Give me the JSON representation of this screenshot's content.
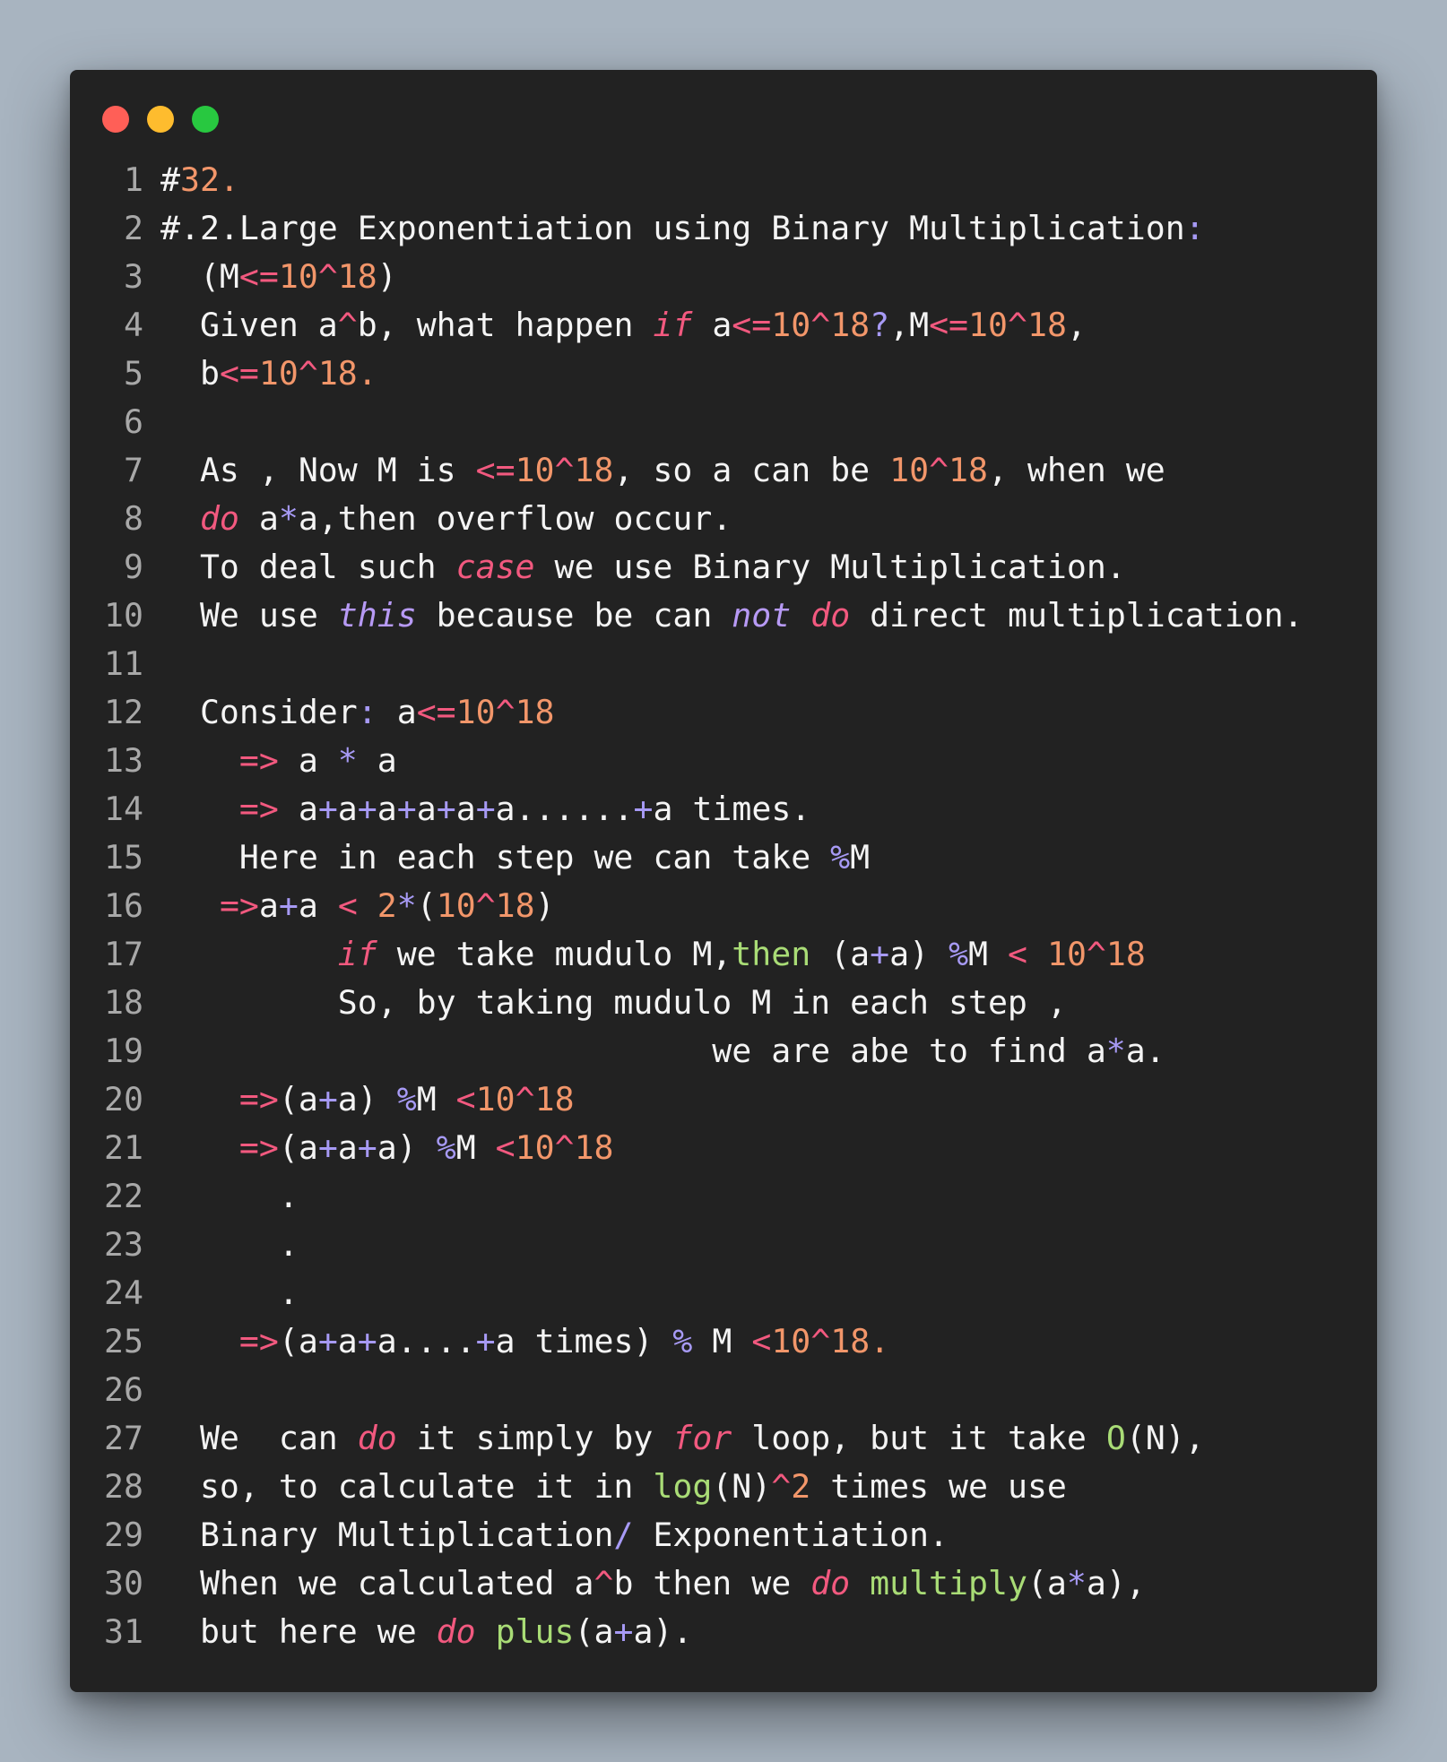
{
  "window": {
    "buttons": [
      {
        "name": "close",
        "color": "#ff5f57"
      },
      {
        "name": "minimize",
        "color": "#febc2e"
      },
      {
        "name": "zoom",
        "color": "#28c840"
      }
    ]
  },
  "colors": {
    "background": "#a8b4c0",
    "editor": "#222222",
    "text": "#f4f4f4",
    "line_number": "#a8a8a8",
    "number": "#f2966a",
    "operator": "#f2597f",
    "punctuation": "#a79af5",
    "keyword": "#f2597f",
    "keyword2": "#b79af5",
    "function": "#a9dc76"
  },
  "lines": [
    {
      "n": "1",
      "tokens": [
        [
          "text",
          "#"
        ],
        [
          "num",
          "32."
        ]
      ]
    },
    {
      "n": "2",
      "tokens": [
        [
          "text",
          "#.2.Large Exponentiation using Binary Multiplication"
        ],
        [
          "punct",
          ":"
        ]
      ]
    },
    {
      "n": "3",
      "tokens": [
        [
          "text",
          "  (M"
        ],
        [
          "op",
          "<="
        ],
        [
          "num",
          "10"
        ],
        [
          "op",
          "^"
        ],
        [
          "num",
          "18"
        ],
        [
          "text",
          ")"
        ]
      ]
    },
    {
      "n": "4",
      "tokens": [
        [
          "text",
          "  Given a"
        ],
        [
          "op",
          "^"
        ],
        [
          "text",
          "b, what happen "
        ],
        [
          "kw",
          "if"
        ],
        [
          "text",
          " a"
        ],
        [
          "op",
          "<="
        ],
        [
          "num",
          "10"
        ],
        [
          "op",
          "^"
        ],
        [
          "num",
          "18"
        ],
        [
          "punct",
          "?"
        ],
        [
          "text",
          ",M"
        ],
        [
          "op",
          "<="
        ],
        [
          "num",
          "10"
        ],
        [
          "op",
          "^"
        ],
        [
          "num",
          "18"
        ],
        [
          "text",
          ","
        ]
      ]
    },
    {
      "n": "5",
      "tokens": [
        [
          "text",
          "  b"
        ],
        [
          "op",
          "<="
        ],
        [
          "num",
          "10"
        ],
        [
          "op",
          "^"
        ],
        [
          "num",
          "18."
        ]
      ]
    },
    {
      "n": "6",
      "tokens": []
    },
    {
      "n": "7",
      "tokens": [
        [
          "text",
          "  As , Now M is "
        ],
        [
          "op",
          "<="
        ],
        [
          "num",
          "10"
        ],
        [
          "op",
          "^"
        ],
        [
          "num",
          "18"
        ],
        [
          "text",
          ", so a can be "
        ],
        [
          "num",
          "10"
        ],
        [
          "op",
          "^"
        ],
        [
          "num",
          "18"
        ],
        [
          "text",
          ", when we"
        ]
      ]
    },
    {
      "n": "8",
      "tokens": [
        [
          "text",
          "  "
        ],
        [
          "kw",
          "do"
        ],
        [
          "text",
          " a"
        ],
        [
          "punct",
          "*"
        ],
        [
          "text",
          "a,then overflow occur."
        ]
      ]
    },
    {
      "n": "9",
      "tokens": [
        [
          "text",
          "  To deal such "
        ],
        [
          "kw",
          "case"
        ],
        [
          "text",
          " we use Binary Multiplication."
        ]
      ]
    },
    {
      "n": "10",
      "tokens": [
        [
          "text",
          "  We use "
        ],
        [
          "kw2",
          "this"
        ],
        [
          "text",
          " because be can "
        ],
        [
          "kw2",
          "not"
        ],
        [
          "text",
          " "
        ],
        [
          "kw",
          "do"
        ],
        [
          "text",
          " direct multiplication."
        ]
      ]
    },
    {
      "n": "11",
      "tokens": []
    },
    {
      "n": "12",
      "tokens": [
        [
          "text",
          "  Consider"
        ],
        [
          "punct",
          ":"
        ],
        [
          "text",
          " a"
        ],
        [
          "op",
          "<="
        ],
        [
          "num",
          "10"
        ],
        [
          "op",
          "^"
        ],
        [
          "num",
          "18"
        ]
      ]
    },
    {
      "n": "13",
      "tokens": [
        [
          "text",
          "    "
        ],
        [
          "op",
          "=>"
        ],
        [
          "text",
          " a "
        ],
        [
          "punct",
          "*"
        ],
        [
          "text",
          " a"
        ]
      ]
    },
    {
      "n": "14",
      "tokens": [
        [
          "text",
          "    "
        ],
        [
          "op",
          "=>"
        ],
        [
          "text",
          " a"
        ],
        [
          "punct",
          "+"
        ],
        [
          "text",
          "a"
        ],
        [
          "punct",
          "+"
        ],
        [
          "text",
          "a"
        ],
        [
          "punct",
          "+"
        ],
        [
          "text",
          "a"
        ],
        [
          "punct",
          "+"
        ],
        [
          "text",
          "a"
        ],
        [
          "punct",
          "+"
        ],
        [
          "text",
          "a......"
        ],
        [
          "punct",
          "+"
        ],
        [
          "text",
          "a times."
        ]
      ]
    },
    {
      "n": "15",
      "tokens": [
        [
          "text",
          "    Here in each step we can take "
        ],
        [
          "punct",
          "%"
        ],
        [
          "text",
          "M"
        ]
      ]
    },
    {
      "n": "16",
      "tokens": [
        [
          "text",
          "   "
        ],
        [
          "op",
          "=>"
        ],
        [
          "text",
          "a"
        ],
        [
          "punct",
          "+"
        ],
        [
          "text",
          "a "
        ],
        [
          "op",
          "<"
        ],
        [
          "text",
          " "
        ],
        [
          "num",
          "2"
        ],
        [
          "punct",
          "*"
        ],
        [
          "text",
          "("
        ],
        [
          "num",
          "10"
        ],
        [
          "op",
          "^"
        ],
        [
          "num",
          "18"
        ],
        [
          "text",
          ")"
        ]
      ]
    },
    {
      "n": "17",
      "tokens": [
        [
          "text",
          "         "
        ],
        [
          "kw",
          "if"
        ],
        [
          "text",
          " we take mudulo M,"
        ],
        [
          "fn",
          "then"
        ],
        [
          "text",
          " (a"
        ],
        [
          "punct",
          "+"
        ],
        [
          "text",
          "a) "
        ],
        [
          "punct",
          "%"
        ],
        [
          "text",
          "M "
        ],
        [
          "op",
          "<"
        ],
        [
          "text",
          " "
        ],
        [
          "num",
          "10"
        ],
        [
          "op",
          "^"
        ],
        [
          "num",
          "18"
        ]
      ]
    },
    {
      "n": "18",
      "tokens": [
        [
          "text",
          "         So, by taking mudulo M in each step ,"
        ]
      ]
    },
    {
      "n": "19",
      "tokens": [
        [
          "text",
          "                            we are abe to find a"
        ],
        [
          "punct",
          "*"
        ],
        [
          "text",
          "a."
        ]
      ]
    },
    {
      "n": "20",
      "tokens": [
        [
          "text",
          "    "
        ],
        [
          "op",
          "=>"
        ],
        [
          "text",
          "(a"
        ],
        [
          "punct",
          "+"
        ],
        [
          "text",
          "a) "
        ],
        [
          "punct",
          "%"
        ],
        [
          "text",
          "M "
        ],
        [
          "op",
          "<"
        ],
        [
          "num",
          "10"
        ],
        [
          "op",
          "^"
        ],
        [
          "num",
          "18"
        ]
      ]
    },
    {
      "n": "21",
      "tokens": [
        [
          "text",
          "    "
        ],
        [
          "op",
          "=>"
        ],
        [
          "text",
          "(a"
        ],
        [
          "punct",
          "+"
        ],
        [
          "text",
          "a"
        ],
        [
          "punct",
          "+"
        ],
        [
          "text",
          "a) "
        ],
        [
          "punct",
          "%"
        ],
        [
          "text",
          "M "
        ],
        [
          "op",
          "<"
        ],
        [
          "num",
          "10"
        ],
        [
          "op",
          "^"
        ],
        [
          "num",
          "18"
        ]
      ]
    },
    {
      "n": "22",
      "tokens": [
        [
          "text",
          "      ."
        ]
      ]
    },
    {
      "n": "23",
      "tokens": [
        [
          "text",
          "      ."
        ]
      ]
    },
    {
      "n": "24",
      "tokens": [
        [
          "text",
          "      ."
        ]
      ]
    },
    {
      "n": "25",
      "tokens": [
        [
          "text",
          "    "
        ],
        [
          "op",
          "=>"
        ],
        [
          "text",
          "(a"
        ],
        [
          "punct",
          "+"
        ],
        [
          "text",
          "a"
        ],
        [
          "punct",
          "+"
        ],
        [
          "text",
          "a...."
        ],
        [
          "punct",
          "+"
        ],
        [
          "text",
          "a times) "
        ],
        [
          "punct",
          "%"
        ],
        [
          "text",
          " M "
        ],
        [
          "op",
          "<"
        ],
        [
          "num",
          "10"
        ],
        [
          "op",
          "^"
        ],
        [
          "num",
          "18."
        ]
      ]
    },
    {
      "n": "26",
      "tokens": []
    },
    {
      "n": "27",
      "tokens": [
        [
          "text",
          "  We  can "
        ],
        [
          "kw",
          "do"
        ],
        [
          "text",
          " it simply by "
        ],
        [
          "kw",
          "for"
        ],
        [
          "text",
          " loop, but it take "
        ],
        [
          "fn",
          "O"
        ],
        [
          "text",
          "(N),"
        ]
      ]
    },
    {
      "n": "28",
      "tokens": [
        [
          "text",
          "  so, to calculate it in "
        ],
        [
          "fn",
          "log"
        ],
        [
          "text",
          "(N)"
        ],
        [
          "op",
          "^"
        ],
        [
          "num",
          "2"
        ],
        [
          "text",
          " times we use"
        ]
      ]
    },
    {
      "n": "29",
      "tokens": [
        [
          "text",
          "  Binary Multiplication"
        ],
        [
          "punct",
          "/"
        ],
        [
          "text",
          " Exponentiation."
        ]
      ]
    },
    {
      "n": "30",
      "tokens": [
        [
          "text",
          "  When we calculated a"
        ],
        [
          "op",
          "^"
        ],
        [
          "text",
          "b then we "
        ],
        [
          "kw",
          "do"
        ],
        [
          "text",
          " "
        ],
        [
          "fn",
          "multiply"
        ],
        [
          "text",
          "(a"
        ],
        [
          "punct",
          "*"
        ],
        [
          "text",
          "a),"
        ]
      ]
    },
    {
      "n": "31",
      "tokens": [
        [
          "text",
          "  but here we "
        ],
        [
          "kw",
          "do"
        ],
        [
          "text",
          " "
        ],
        [
          "fn",
          "plus"
        ],
        [
          "text",
          "(a"
        ],
        [
          "punct",
          "+"
        ],
        [
          "text",
          "a)."
        ]
      ]
    }
  ]
}
